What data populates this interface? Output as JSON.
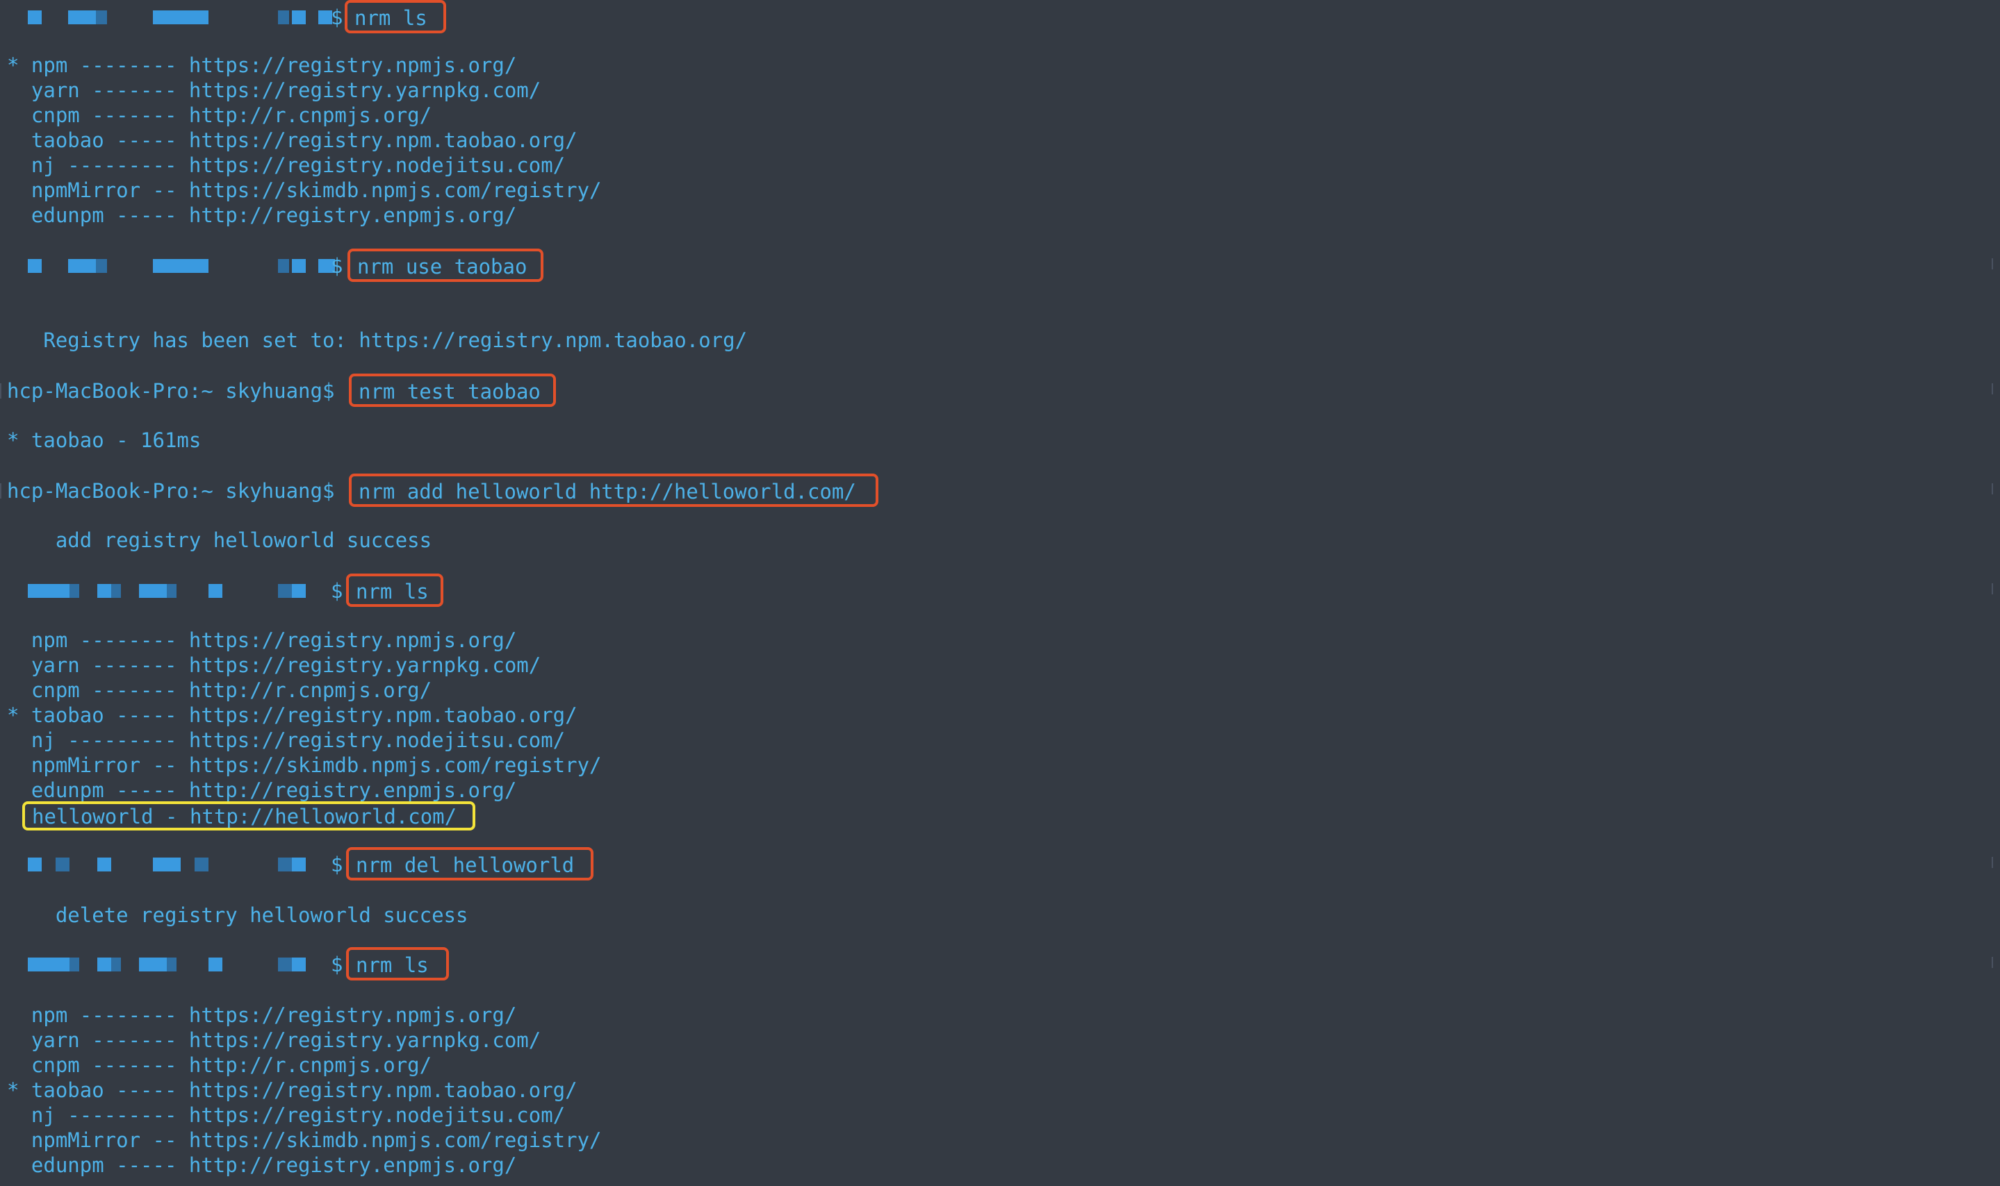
{
  "terminal": {
    "colors": {
      "background": "#343a43",
      "text": "#4db1e8",
      "command_box": "#e2502a",
      "highlight_box": "#f3e33a"
    },
    "prompt": {
      "dollar": "$",
      "host_prompt": "hcp-MacBook-Pro:~ skyhuang$"
    },
    "commands": {
      "ls_1": "nrm ls",
      "use": "nrm use taobao",
      "test": "nrm test taobao",
      "add": "nrm add helloworld http://helloworld.com/",
      "ls_2": "nrm ls",
      "del": "nrm del helloworld",
      "ls_3": "nrm ls"
    },
    "list_1": [
      "* npm -------- https://registry.npmjs.org/",
      "  yarn ------- https://registry.yarnpkg.com/",
      "  cnpm ------- http://r.cnpmjs.org/",
      "  taobao ----- https://registry.npm.taobao.org/",
      "  nj --------- https://registry.nodejitsu.com/",
      "  npmMirror -- https://skimdb.npmjs.com/registry/",
      "  edunpm ----- http://registry.enpmjs.org/"
    ],
    "output_use": "   Registry has been set to: https://registry.npm.taobao.org/",
    "output_test": "* taobao - 161ms",
    "output_add": "    add registry helloworld success",
    "list_2": [
      "  npm -------- https://registry.npmjs.org/",
      "  yarn ------- https://registry.yarnpkg.com/",
      "  cnpm ------- http://r.cnpmjs.org/",
      "* taobao ----- https://registry.npm.taobao.org/",
      "  nj --------- https://registry.nodejitsu.com/",
      "  npmMirror -- https://skimdb.npmjs.com/registry/",
      "  edunpm ----- http://registry.enpmjs.org/"
    ],
    "list_2_highlight": "helloworld - http://helloworld.com/",
    "output_del": "    delete registry helloworld success",
    "list_3": [
      "  npm -------- https://registry.npmjs.org/",
      "  yarn ------- https://registry.yarnpkg.com/",
      "  cnpm ------- http://r.cnpmjs.org/",
      "* taobao ----- https://registry.npm.taobao.org/",
      "  nj --------- https://registry.nodejitsu.com/",
      "  npmMirror -- https://skimdb.npmjs.com/registry/",
      "  edunpm ----- http://registry.enpmjs.org/"
    ]
  }
}
